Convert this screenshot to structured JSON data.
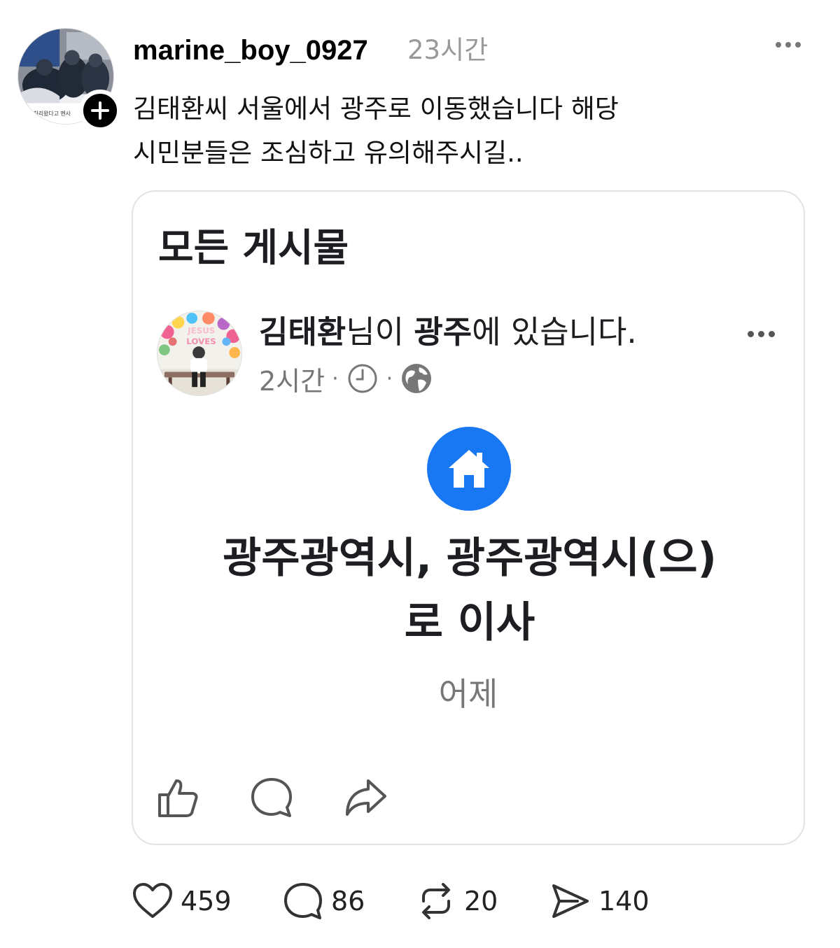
{
  "post": {
    "username": "marine_boy_0927",
    "timestamp": "23시간",
    "caption_line1": "김태환씨 서울에서 광주로 이동했습니다 해당",
    "caption_line2": "시민분들은 조심하고 유의해주시길..",
    "avatar_text": "처리왔다고 멘사",
    "icons": {
      "follow": "plus-icon",
      "more": "more-horizontal-icon"
    }
  },
  "embed": {
    "section_title": "모든 게시물",
    "author_name": "김태환",
    "author_suffix": "님이 ",
    "location": "광주",
    "location_suffix": "에 있습니다.",
    "time": "2시간",
    "separator": "·",
    "avatar_text_1": "JESUS",
    "avatar_text_2": "LOVES",
    "life_event_line1": "광주광역시, 광주광역시(으)",
    "life_event_line2": "로 이사",
    "life_event_date": "어제",
    "icons": [
      "clock-icon",
      "globe-icon",
      "house-icon",
      "like-icon",
      "comment-icon",
      "share-icon"
    ],
    "accent_color": "#1877f2"
  },
  "stats": {
    "likes": "459",
    "comments": "86",
    "reposts": "20",
    "shares": "140"
  }
}
